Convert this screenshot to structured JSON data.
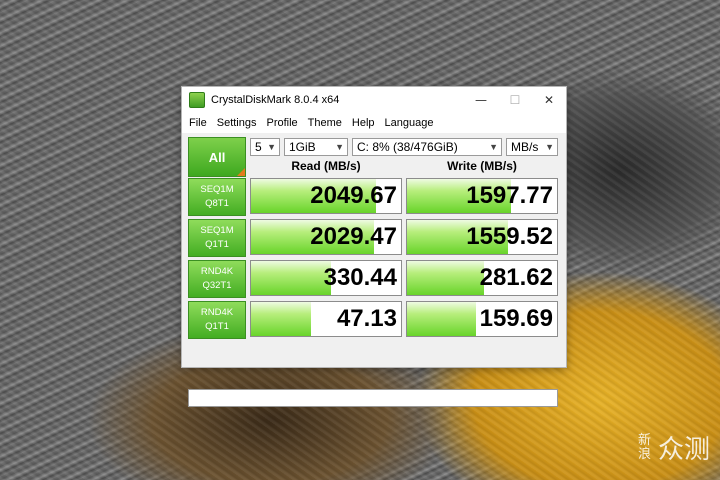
{
  "window": {
    "title": "CrystalDiskMark 8.0.4 x64",
    "minimize": "—",
    "maximize": "☐",
    "close": "✕"
  },
  "menu": [
    "File",
    "Settings",
    "Profile",
    "Theme",
    "Help",
    "Language"
  ],
  "controls": {
    "all_label": "All",
    "count": "5",
    "size": "1GiB",
    "drive": "C: 8% (38/476GiB)",
    "unit": "MB/s"
  },
  "headers": {
    "read": "Read (MB/s)",
    "write": "Write (MB/s)"
  },
  "tests": [
    {
      "line1": "SEQ1M",
      "line2": "Q8T1",
      "read": "2049.67",
      "write": "1597.77",
      "read_fill": 0.83,
      "write_fill": 0.69
    },
    {
      "line1": "SEQ1M",
      "line2": "Q1T1",
      "read": "2029.47",
      "write": "1559.52",
      "read_fill": 0.82,
      "write_fill": 0.67
    },
    {
      "line1": "RND4K",
      "line2": "Q32T1",
      "read": "330.44",
      "write": "281.62",
      "read_fill": 0.53,
      "write_fill": 0.51
    },
    {
      "line1": "RND4K",
      "line2": "Q1T1",
      "read": "47.13",
      "write": "159.69",
      "read_fill": 0.4,
      "write_fill": 0.46
    }
  ],
  "comment": "",
  "watermark": {
    "small": "新浪",
    "big": "众测"
  },
  "colors": {
    "bar_green": "#68d42a",
    "button_green": "#43ad22",
    "flag_orange": "#e37b1d"
  }
}
